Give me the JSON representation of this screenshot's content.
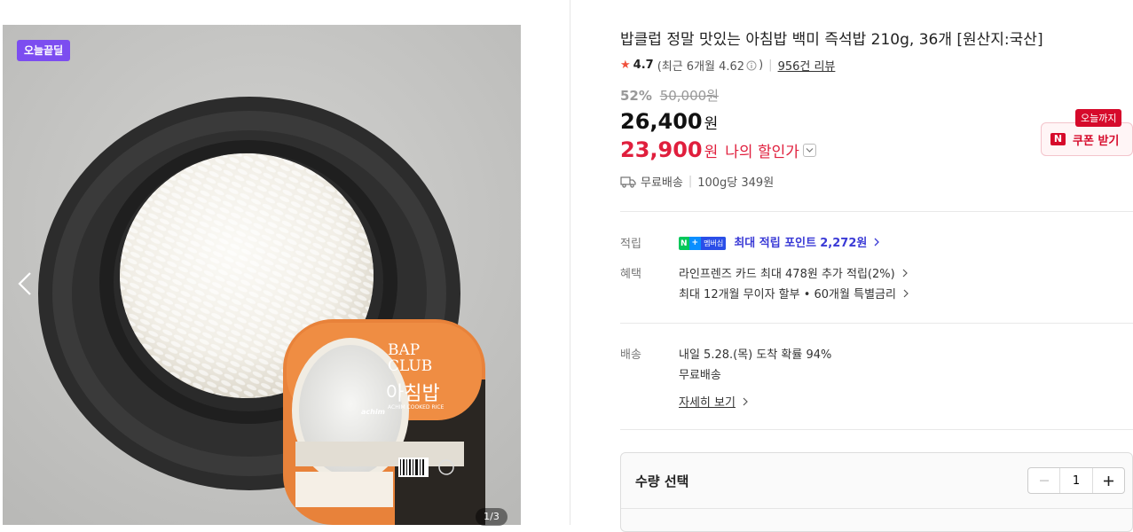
{
  "gallery": {
    "badge": "오늘끝딜",
    "counter": "1/3",
    "package_brand": "BAP\nCLUB",
    "package_name": "아침밥",
    "package_sub": "ACHIM COOKED RICE",
    "package_maker": "achim"
  },
  "product": {
    "title": "밥클럽 정말 맛있는 아침밥 백미 즉석밥 210g, 36개 [원산지:국산]",
    "rating": "4.7",
    "rating_detail": "(최근 6개월 4.62",
    "rating_paren_close": ")",
    "review_count": "956건 리뷰",
    "discount_pct": "52%",
    "original_price": "50,000원",
    "price": "26,400",
    "price_unit": "원",
    "my_price": "23,900",
    "my_price_unit": "원",
    "my_price_label": "나의 할인가"
  },
  "coupon": {
    "tag": "오늘까지",
    "logo": "N",
    "label": "쿠폰 받기"
  },
  "shipping_summary": {
    "free": "무료배송",
    "unit_price": "100g당 349원"
  },
  "points": {
    "label": "적립",
    "badge_n": "N",
    "badge_plus": "+",
    "badge_member": "멤버십",
    "text": "최대 적립 포인트",
    "amount": "2,272원"
  },
  "benefits": {
    "label": "혜택",
    "line1": "라인프렌즈 카드 최대 478원 추가 적립(2%)",
    "line2": "최대 12개월 무이자 할부 • 60개월 특별금리"
  },
  "delivery": {
    "label": "배송",
    "line1": "내일 5.28.(목) 도착 확률 94%",
    "line2": "무료배송",
    "detail_link": "자세히 보기"
  },
  "quantity": {
    "label": "수량 선택",
    "value": "1"
  }
}
